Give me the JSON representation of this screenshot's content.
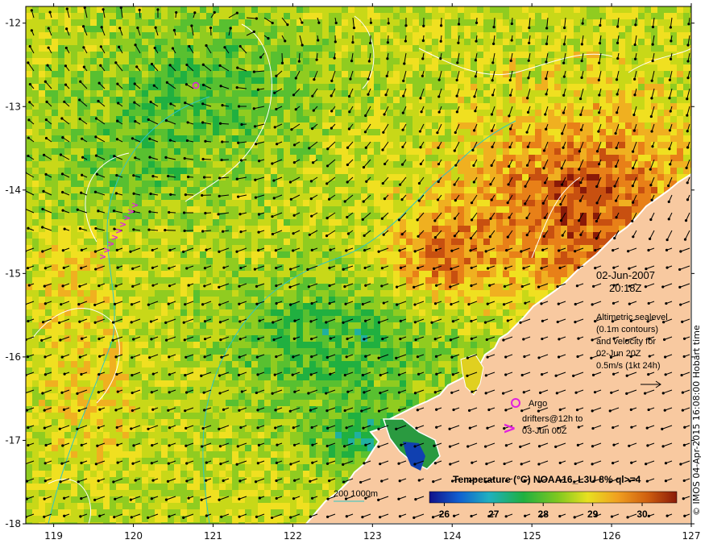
{
  "map": {
    "lat_labels": [
      "-12",
      "-13",
      "-14",
      "-15",
      "-16",
      "-17",
      "-18"
    ],
    "lon_labels": [
      "119",
      "120",
      "121",
      "122",
      "123",
      "124",
      "125",
      "126",
      "127"
    ],
    "lon_range": [
      118.65,
      127.0
    ],
    "lat_range": [
      -18.0,
      -11.8
    ]
  },
  "annotations": {
    "date": "02-Jun-2007",
    "time": "20:18Z",
    "sealevel_lines": [
      "Altimetric sealevel",
      "(0.1m contours)",
      "and velocity for",
      "02-Jun 20Z",
      "0.5m/s (1kt 24h)"
    ],
    "argo_label": "Argo",
    "drifters_lines": [
      "drifters@12h to",
      "03-Jun 00Z"
    ],
    "drifter_symbol": ">",
    "bathy_label": "200  1000m"
  },
  "colorbar": {
    "title": "Temperature (°C) NOAA16_L3U 8% ql>=4",
    "ticks": [
      "26",
      "27",
      "28",
      "29",
      "30"
    ],
    "range": [
      25.7,
      30.7
    ]
  },
  "credit": "© IMOS 04-Apr-2015 16:08:00 Hobart time",
  "colors": {
    "land": "#f8c9a0",
    "arrow": "#000000",
    "contour": "#ffffff",
    "bathymetry": "#2ec6c6",
    "argo": "#e020e0",
    "drifter": "#e020e0"
  }
}
